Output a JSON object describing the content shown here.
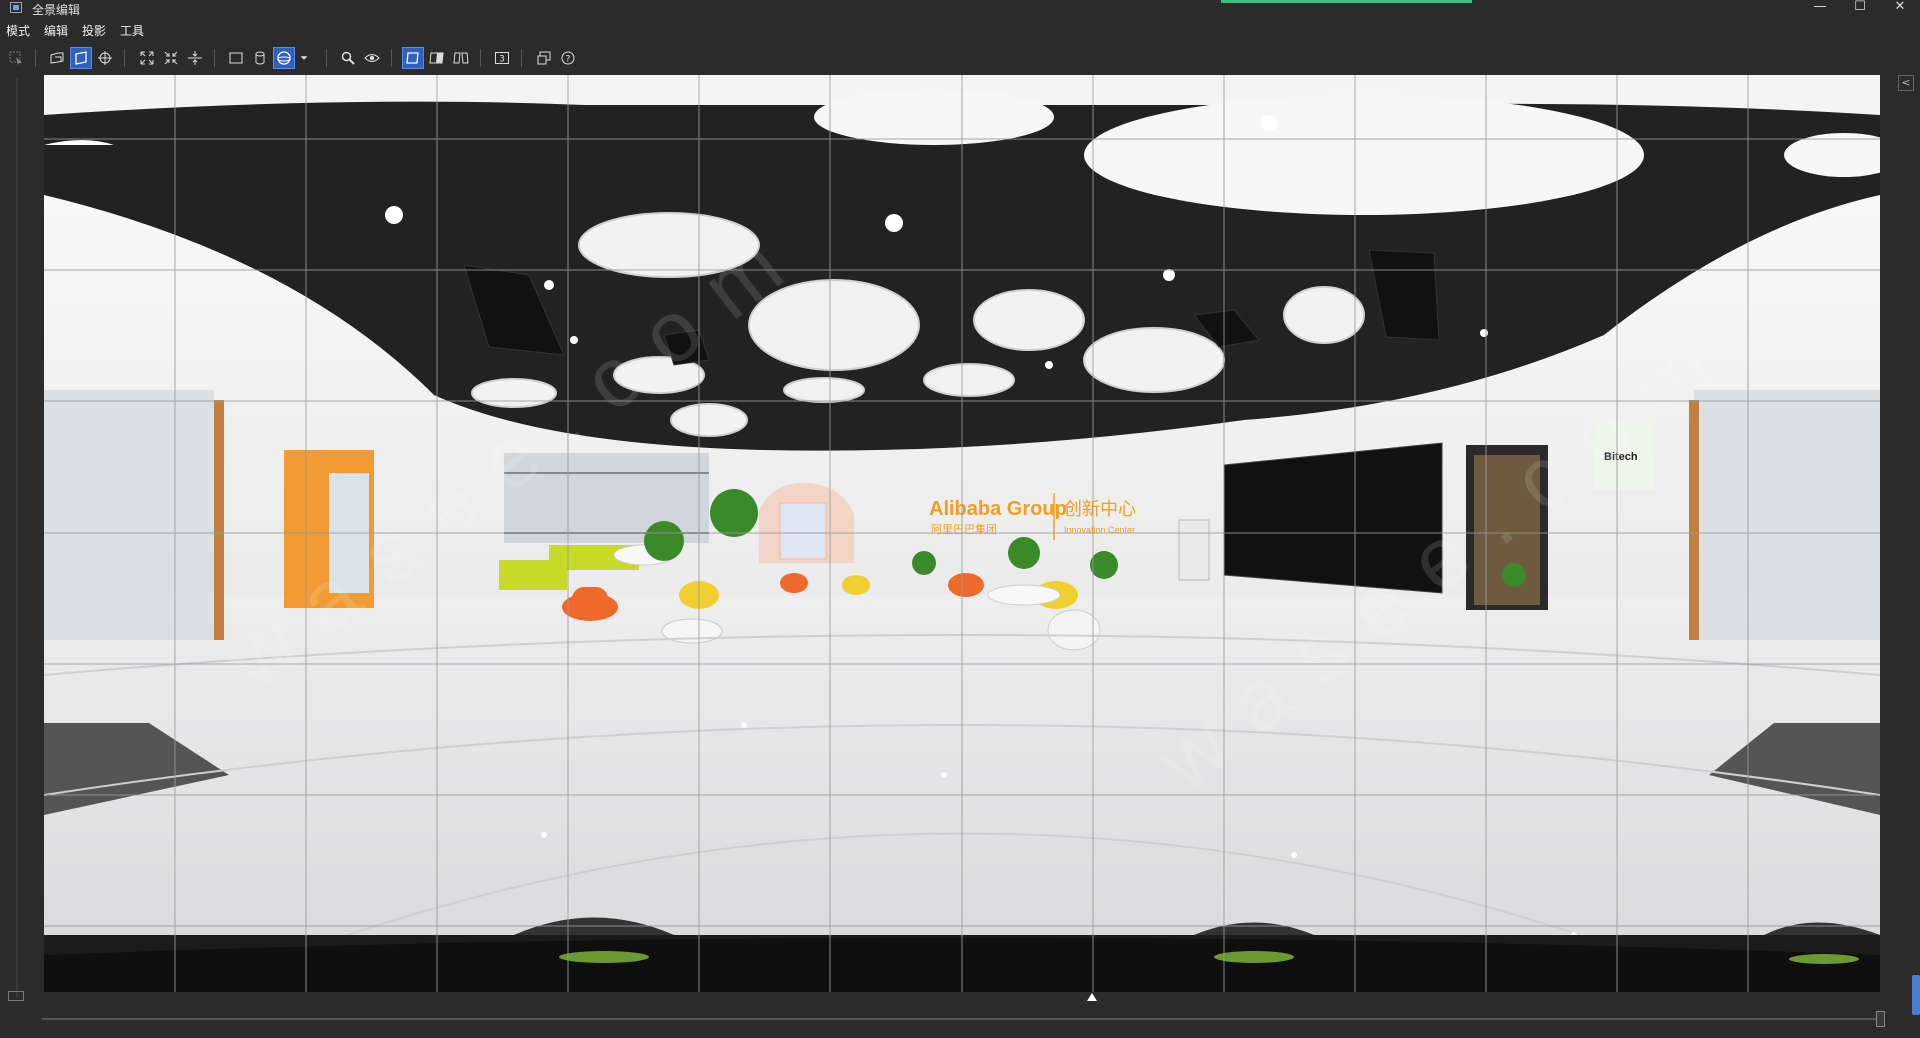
{
  "window": {
    "title": "全景编辑",
    "minimize_label": "—",
    "maximize_label": "☐",
    "close_label": "✕"
  },
  "menu": [
    {
      "label": "模式"
    },
    {
      "label": "编辑"
    },
    {
      "label": "投影"
    },
    {
      "label": "工具"
    }
  ],
  "toolbar": {
    "tools": [
      {
        "icon": "select-arrow-icon"
      },
      {
        "icon": "perspective-plane-icon"
      },
      {
        "icon": "warp-plane-icon",
        "active": true
      },
      {
        "icon": "crosshair-icon"
      },
      {
        "icon": "expand-icon"
      },
      {
        "icon": "shrink-icon"
      },
      {
        "icon": "horizon-icon"
      },
      {
        "icon": "rectilinear-icon"
      },
      {
        "icon": "cylinder-icon"
      },
      {
        "icon": "sphere-icon",
        "active": true
      },
      {
        "icon": "chevron-down-icon"
      },
      {
        "icon": "search-icon"
      },
      {
        "icon": "eye-icon"
      },
      {
        "icon": "view-single-icon",
        "active": true
      },
      {
        "icon": "view-split-icon"
      },
      {
        "icon": "view-mirror-icon"
      },
      {
        "icon": "badge-3-icon"
      },
      {
        "icon": "window-icon"
      },
      {
        "icon": "help-icon"
      }
    ],
    "badge_text": "3",
    "help_text": "?"
  },
  "viewport": {
    "sign_brand": "Alibaba Group",
    "sign_brand_cn": "阿里巴巴集团",
    "sign_center_cn": "创新中心",
    "sign_center_en": "Innovation Center",
    "screen_label": "Bitech",
    "watermark": "wasee.com"
  },
  "colors": {
    "accent": "#2f5fbf",
    "progress": "#3fbf7f"
  }
}
